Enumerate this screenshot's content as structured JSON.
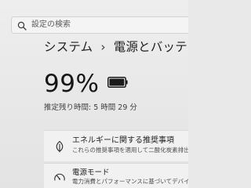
{
  "search": {
    "placeholder": "設定の検索",
    "icon": "search-icon"
  },
  "breadcrumb": {
    "parent": "システム",
    "separator": "›",
    "current": "電源とバッテリー"
  },
  "battery": {
    "percent": "99%",
    "level": 0.99,
    "remaining_label": "推定残り時間: 5 時間 29 分"
  },
  "cards": {
    "recommendations": {
      "icon": "leaf-icon",
      "title": "エネルギーに関する推奨事項",
      "subtitle": "これらの推奨事項を適用して二酸化炭素排出量を"
    },
    "power_mode": {
      "icon": "gauge-icon",
      "title": "電源モード",
      "subtitle": "電力消費とパフォーマンスに基づいてデバイスを最適化"
    }
  }
}
